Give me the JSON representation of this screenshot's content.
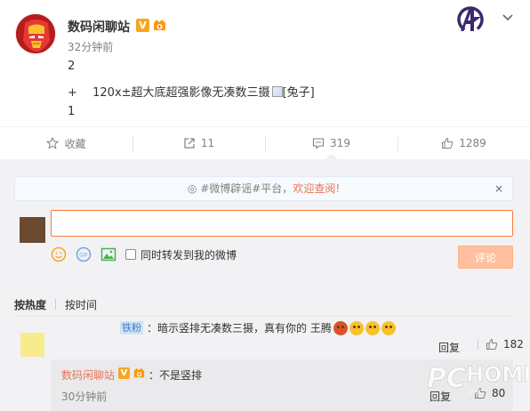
{
  "post": {
    "author": "数码闲聊站",
    "verified_mark": "V",
    "time": "32分钟前",
    "line1": "2",
    "line2_prefix": "+",
    "line2_text": "120x±超大底超强影像无凑数三摄",
    "line2_img_alt": "[兔子]",
    "line3": "1"
  },
  "actions": {
    "favorite": "收藏",
    "repost": "11",
    "comment": "319",
    "like": "1289"
  },
  "comment_box": {
    "notice_prefix": "#微博辟谣#平台，",
    "notice_link": "欢迎查阅!",
    "close": "×",
    "input_value": "",
    "repost_label": "同时转发到我的微博",
    "submit": "评论"
  },
  "sort": {
    "hot": "按热度",
    "time": "按时间"
  },
  "comments": [
    {
      "fan_tag": "铁粉",
      "text": "：暗示竖排无凑数三摄，真有你的 王腾",
      "reply": "回复",
      "likes": "182",
      "sub": {
        "author": "数码闲聊站",
        "verified_mark": "V",
        "text": "：不是竖排",
        "time": "30分钟前",
        "reply": "回复",
        "likes": "80"
      }
    }
  ],
  "colors": {
    "accent": "#fa7d3c",
    "link": "#eb7350",
    "muted": "#808080",
    "background": "#f2f2f5"
  }
}
